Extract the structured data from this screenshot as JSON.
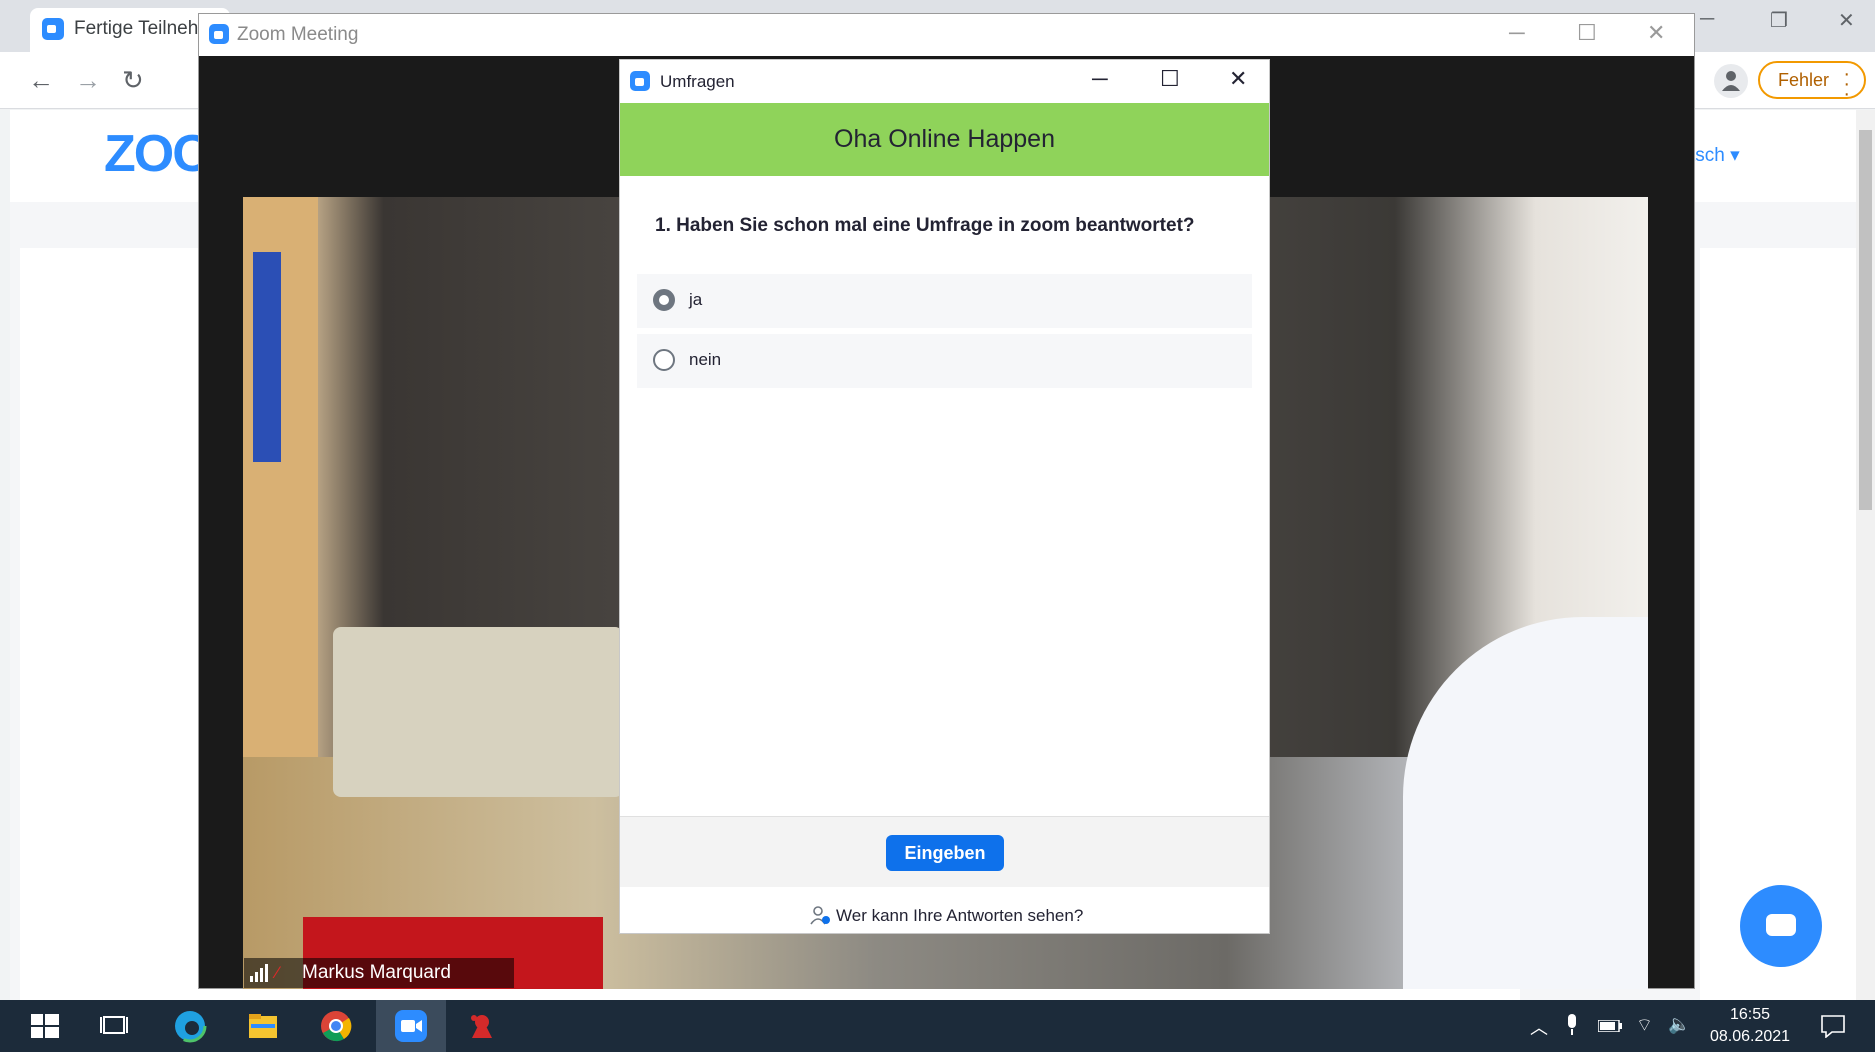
{
  "browser": {
    "tab_title": "Fertige Teilnehm",
    "nav": {
      "back": "←",
      "forward": "→",
      "reload": "↻"
    },
    "window_controls": {
      "minimize": "─",
      "restore": "❐",
      "close": "✕"
    },
    "error_badge": "Fehler",
    "page": {
      "logo": "ZOO",
      "language": "tsch ▾"
    }
  },
  "zoom_meeting": {
    "title": "Zoom Meeting",
    "participant_name": "Markus Marquard"
  },
  "poll": {
    "window_title": "Umfragen",
    "banner": "Oha Online Happen",
    "question": "1. Haben Sie schon mal eine Umfrage in zoom beantwortet?",
    "options": [
      {
        "label": "ja",
        "selected": true
      },
      {
        "label": "nein",
        "selected": false
      }
    ],
    "submit_label": "Eingeben",
    "privacy_link": "Wer kann Ihre Antworten sehen?",
    "banner_color": "#8fd35a",
    "submit_color": "#0e71eb"
  },
  "taskbar": {
    "time": "16:55",
    "date": "08.06.2021",
    "apps": [
      "windows-start",
      "task-view",
      "edge",
      "file-explorer",
      "chrome",
      "zoom",
      "app"
    ]
  }
}
